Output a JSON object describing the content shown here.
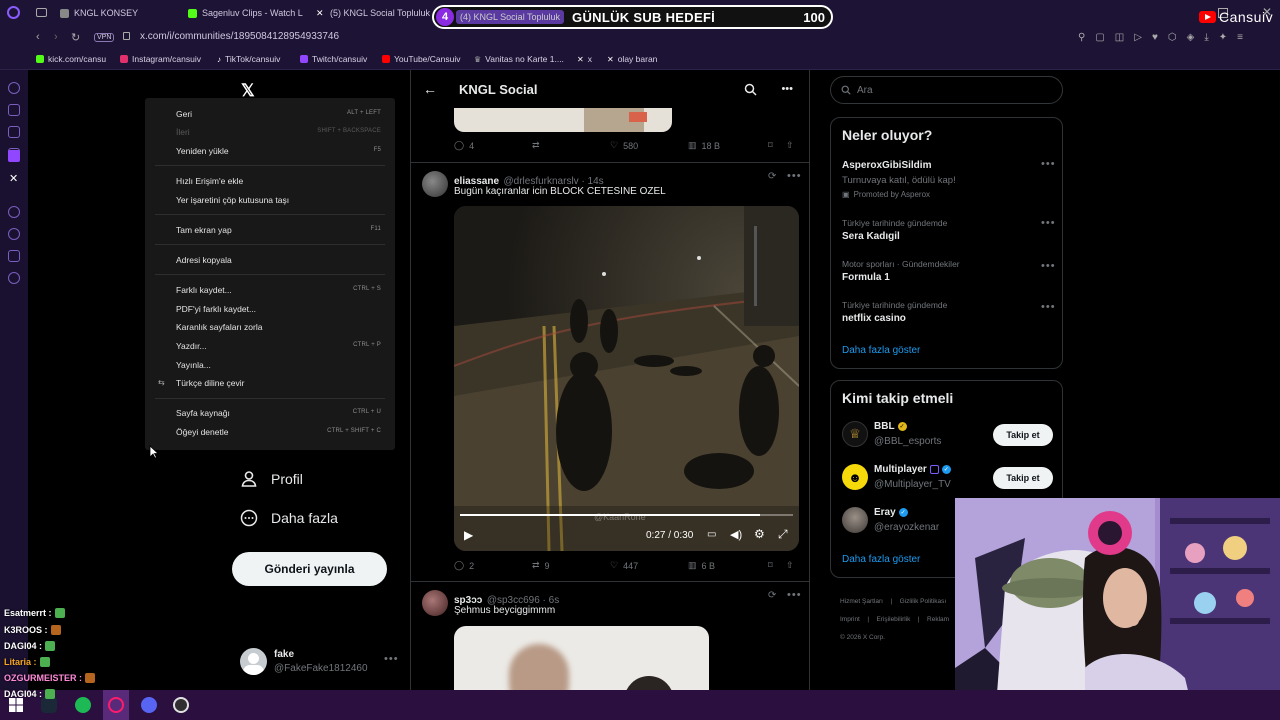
{
  "browser": {
    "tabs": [
      {
        "label": "KNGL KONSEY",
        "color": "#888888"
      },
      {
        "label": "Sagenluv Clips - Watch Li",
        "color": "#53fc18"
      },
      {
        "label": "(5) KNGL Social Topluluk",
        "color": "#cccccc"
      },
      {
        "label": "(4) KNGL Social Topluluk",
        "color": "#cccccc"
      }
    ],
    "vpn": "VPN",
    "url": "x.com/i/communities/1895084128954933746",
    "bookmarks": [
      {
        "label": "kick.com/cansu",
        "color": "#53fc18"
      },
      {
        "label": "Instagram/cansuiv",
        "color": "#e1306c"
      },
      {
        "label": "TikTok/cansuiv",
        "color": "#ffffff"
      },
      {
        "label": "Twitch/cansuiv",
        "color": "#9146ff"
      },
      {
        "label": "YouTube/Cansuiv",
        "color": "#ff0000"
      },
      {
        "label": "Vanitas no Karte 1....",
        "color": "#aaaaaa"
      },
      {
        "label": "x",
        "color": "#ffffff"
      },
      {
        "label": "olay baran",
        "color": "#ffffff"
      }
    ]
  },
  "overlay": {
    "goal_number": "4",
    "goal_title": "GÜNLÜK SUB HEDEFİ",
    "goal_value": "100",
    "channel_name": "Cansuiv"
  },
  "context_menu": {
    "items": [
      {
        "label": "Geri",
        "shortcut": "ALT + LEFT",
        "disabled": false
      },
      {
        "label": "İleri",
        "shortcut": "SHIFT + BACKSPACE",
        "disabled": true
      },
      {
        "label": "Yeniden yükle",
        "shortcut": "F5",
        "disabled": false
      },
      {
        "label": "Hızlı Erişim'e ekle",
        "shortcut": "",
        "disabled": false
      },
      {
        "label": "Yer işaretini çöp kutusuna taşı",
        "shortcut": "",
        "disabled": false
      },
      {
        "label": "Tam ekran yap",
        "shortcut": "F11",
        "disabled": false
      },
      {
        "label": "Adresi kopyala",
        "shortcut": "",
        "disabled": false
      },
      {
        "label": "Farklı kaydet...",
        "shortcut": "CTRL + S",
        "disabled": false
      },
      {
        "label": "PDF'yi farklı kaydet...",
        "shortcut": "",
        "disabled": false
      },
      {
        "label": "Karanlık sayfaları zorla",
        "shortcut": "",
        "disabled": false
      },
      {
        "label": "Yazdır...",
        "shortcut": "CTRL + P",
        "disabled": false
      },
      {
        "label": "Yayınla...",
        "shortcut": "",
        "disabled": false
      },
      {
        "label": "Türkçe diline çevir",
        "shortcut": "",
        "disabled": false
      },
      {
        "label": "Sayfa kaynağı",
        "shortcut": "CTRL + U",
        "disabled": false
      },
      {
        "label": "Öğeyi denetle",
        "shortcut": "CTRL + SHIFT + C",
        "disabled": false
      }
    ]
  },
  "x_nav": {
    "profile": "Profil",
    "more": "Daha fazla",
    "post_button": "Gönderi yayınla",
    "account_name": "fake",
    "account_handle": "@FakeFake1812460"
  },
  "chat": [
    {
      "user": "Esatmerrt :",
      "color": "#ffffff",
      "badge": "#4caf50"
    },
    {
      "user": "K3ROOS :",
      "color": "#ffffff",
      "badge": "#b5651d"
    },
    {
      "user": "DAGI04 :",
      "color": "#ffffff",
      "badge": "#4caf50"
    },
    {
      "user": "Litaria :",
      "color": "#f5a623",
      "badge": "#4caf50"
    },
    {
      "user": "OZGURMEISTER :",
      "color": "#ff8ad8",
      "badge": "#b5651d"
    },
    {
      "user": "DAGI04 :",
      "color": "#ffffff",
      "badge": "#4caf50"
    }
  ],
  "timeline": {
    "title": "KNGL Social",
    "post0_stats": {
      "replies": "4",
      "retweets": "",
      "likes": "580",
      "views": "18 B"
    },
    "post1": {
      "name": "eliassane",
      "handle": "@drlesfurknarslv · 14s",
      "text": "Bugün kaçıranlar icin BLOCK CETESINE OZEL",
      "video_time": "0:27 / 0:30",
      "video_progress": 0.9,
      "watermark": "@KaanRone",
      "stats": {
        "replies": "2",
        "retweets": "9",
        "likes": "447",
        "views": "6 B"
      }
    },
    "post2": {
      "name": "sp3ɔɔ",
      "handle": "@sp3cc696 · 6s",
      "text": "Şehmus beyciggimmm"
    }
  },
  "right": {
    "search_placeholder": "Ara",
    "trends_title": "Neler oluyor?",
    "trends": [
      {
        "meta": "",
        "title": "AsperoxGibiSildim",
        "sub": "Turnuvaya katıl, ödülü kap!",
        "promo": "Promoted by Asperox"
      },
      {
        "meta": "Türkiye tarihinde gündemde",
        "title": "Sera Kadıgil",
        "sub": "",
        "promo": ""
      },
      {
        "meta": "Motor sporları · Gündemdekiler",
        "title": "Formula 1",
        "sub": "",
        "promo": ""
      },
      {
        "meta": "Türkiye tarihinde gündemde",
        "title": "netflix casino",
        "sub": "",
        "promo": ""
      }
    ],
    "trends_more": "Daha fazla göster",
    "follow_title": "Kimi takip etmeli",
    "follow": [
      {
        "name": "BBL",
        "handle": "@BBL_esports",
        "button": "Takip et"
      },
      {
        "name": "Multiplayer",
        "handle": "@Multiplayer_TV",
        "button": "Takip et"
      },
      {
        "name": "Eray",
        "handle": "@erayozkenar",
        "button": ""
      }
    ],
    "follow_more": "Daha fazla göster",
    "footer": [
      "Hizmet Şartları",
      "Gizlilik Politikası",
      "Imprint",
      "Erişilebilirlik",
      "Reklam",
      "© 2026 X Corp."
    ]
  }
}
